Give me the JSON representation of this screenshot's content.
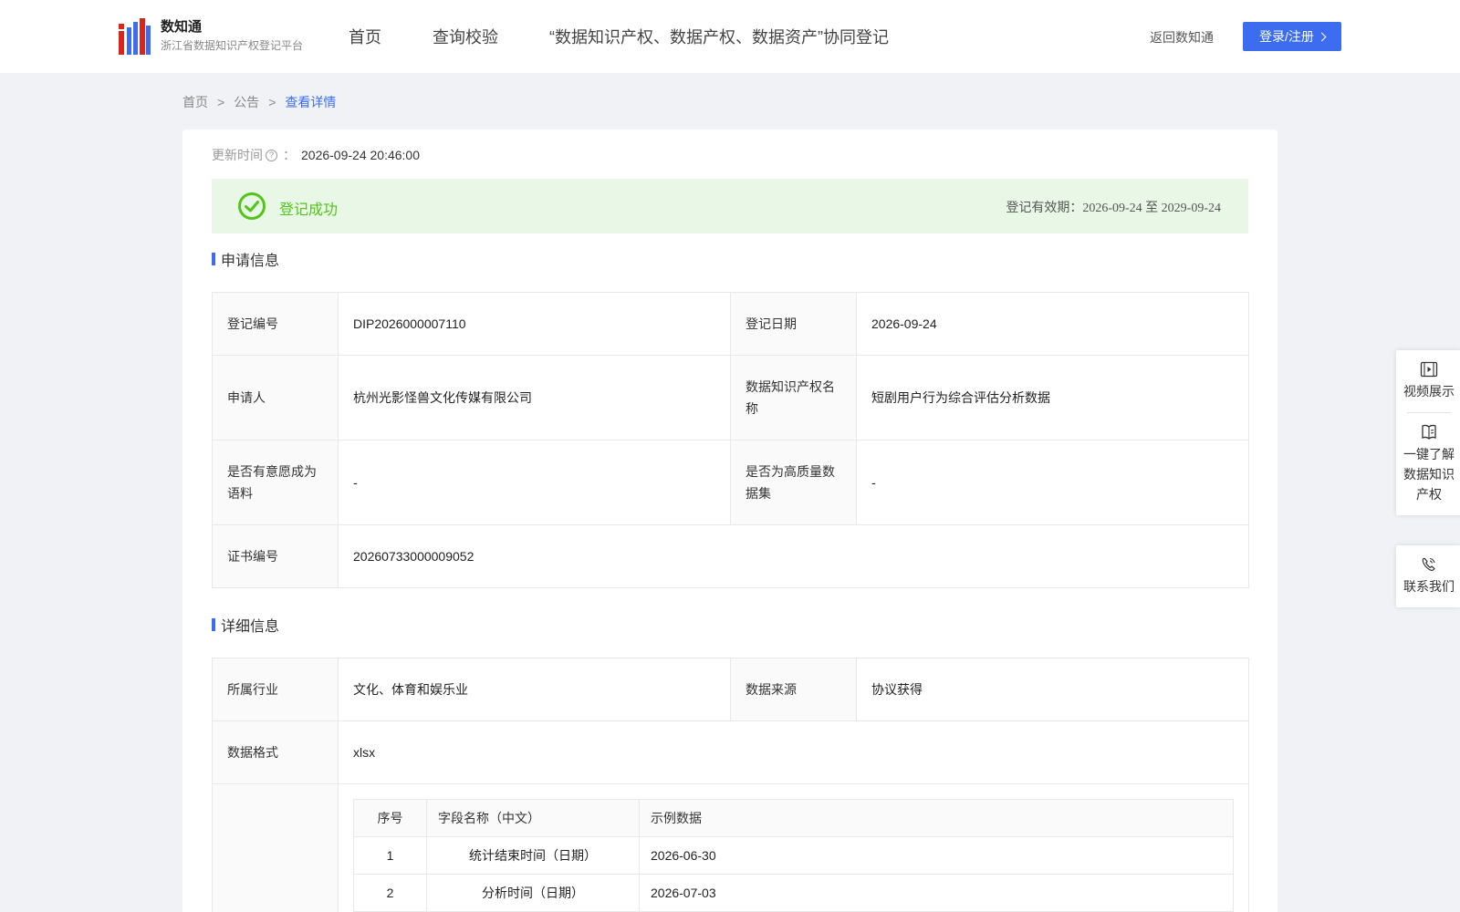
{
  "header": {
    "logo_title": "数知通",
    "logo_subtitle": "浙江省数据知识产权登记平台",
    "nav": [
      "首页",
      "查询校验",
      "“数据知识产权、数据产权、数据资产”协同登记"
    ],
    "back_link": "返回数知通",
    "login_button": "登录/注册"
  },
  "breadcrumb": [
    "首页",
    "公告",
    "查看详情"
  ],
  "breadcrumb_sep": ">",
  "update": {
    "label": "更新时间",
    "colon": "：",
    "value": "2026-09-24 20:46:00"
  },
  "status": {
    "text": "登记成功",
    "validity": "登记有效期：2026-09-24 至 2029-09-24"
  },
  "application": {
    "title": "申请信息",
    "reg_no_label": "登记编号",
    "reg_no": "DIP2026000007110",
    "reg_date_label": "登记日期",
    "reg_date": "2026-09-24",
    "applicant_label": "申请人",
    "applicant": "杭州光影怪兽文化传媒有限公司",
    "ip_name_label": "数据知识产权名称",
    "ip_name": "短剧用户行为综合评估分析数据",
    "corpus_label": "是否有意愿成为语料",
    "corpus": "-",
    "hq_label": "是否为高质量数据集",
    "hq": "-",
    "cert_label": "证书编号",
    "cert": "20260733000009052"
  },
  "detail": {
    "title": "详细信息",
    "industry_label": "所属行业",
    "industry": "文化、体育和娱乐业",
    "source_label": "数据来源",
    "source": "协议获得",
    "format_label": "数据格式",
    "format": "xlsx",
    "fields_headers": [
      "序号",
      "字段名称（中文）",
      "示例数据"
    ],
    "fields": [
      {
        "no": "1",
        "name": "统计结束时间（日期）",
        "example": "2026-06-30"
      },
      {
        "no": "2",
        "name": "分析时间（日期）",
        "example": "2026-07-03"
      }
    ]
  },
  "side_panel": {
    "video": "视频展示",
    "learn": "一键了解数据知识产权",
    "contact": "联系我们"
  },
  "colors": {
    "primary": "#3c6df0",
    "success": "#52c41a",
    "success_bg": "#e9f7e6"
  }
}
